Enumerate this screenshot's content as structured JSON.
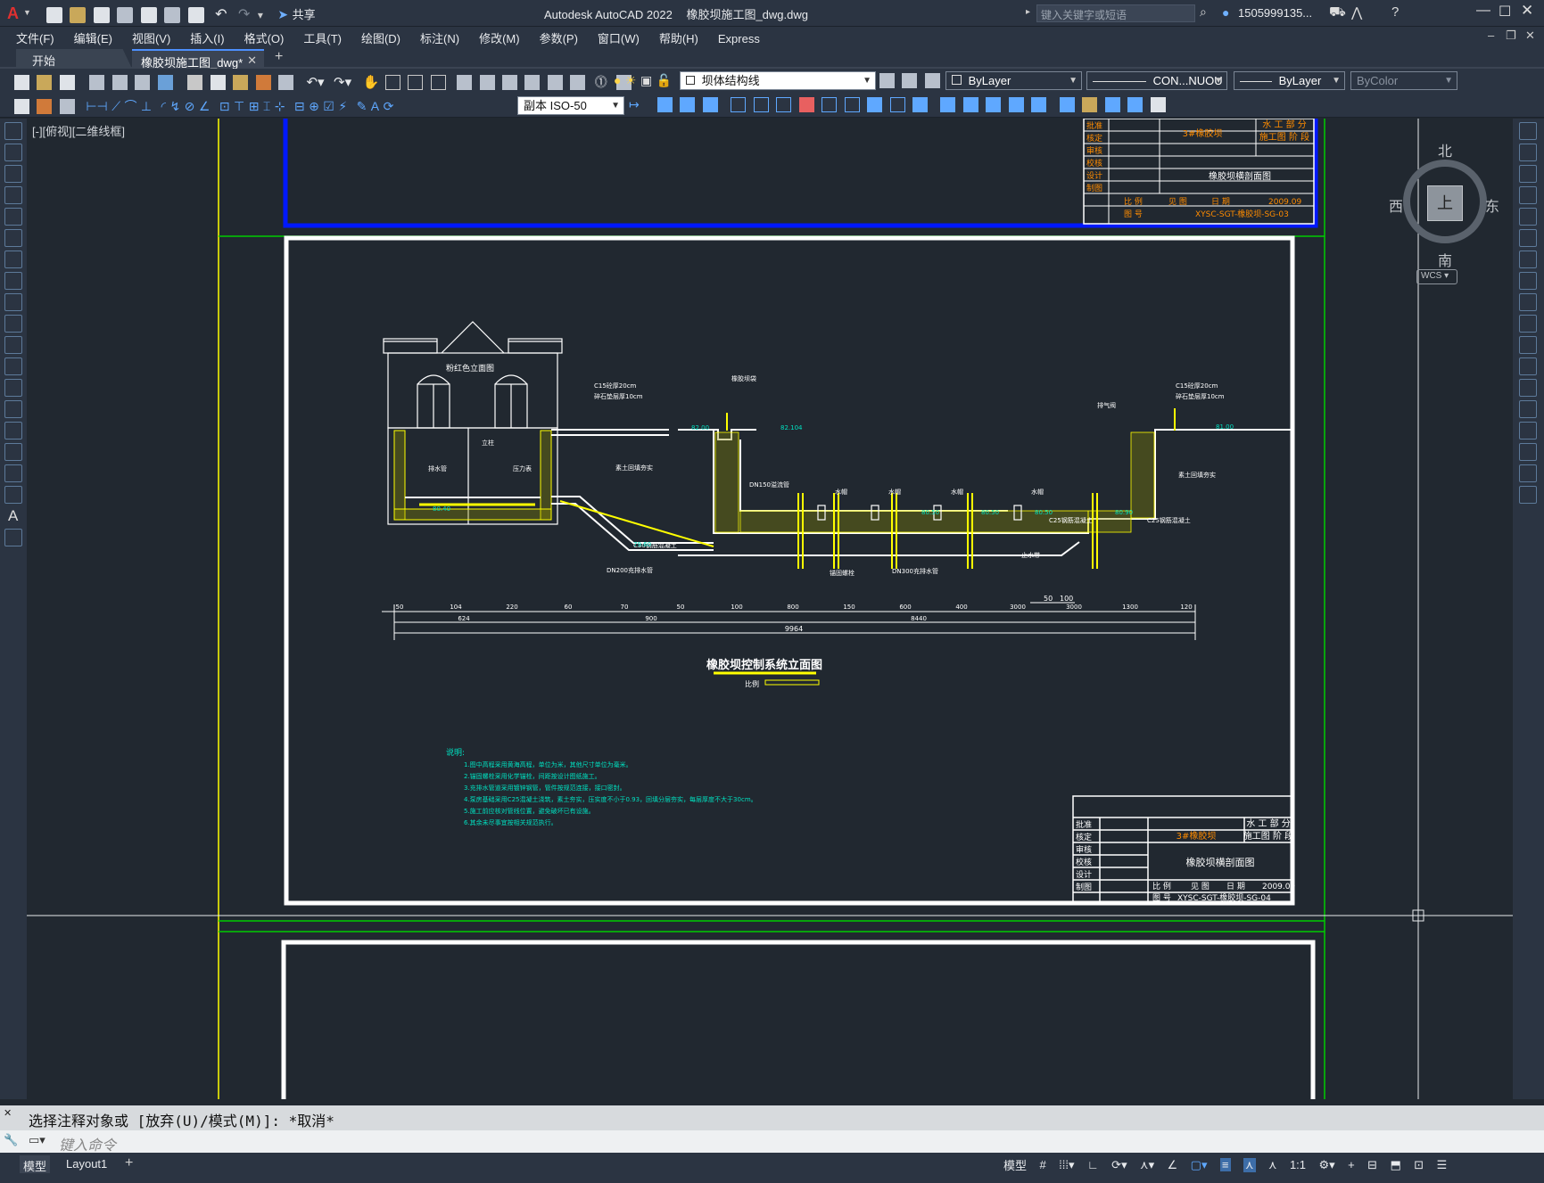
{
  "app": {
    "title": "Autodesk AutoCAD 2022",
    "filename": "橡胶坝施工图_dwg.dwg",
    "share_label": "共享",
    "search_placeholder": "键入关键字或短语",
    "user": "1505999135...",
    "logo_letter": "A"
  },
  "menu": [
    "文件(F)",
    "编辑(E)",
    "视图(V)",
    "插入(I)",
    "格式(O)",
    "工具(T)",
    "绘图(D)",
    "标注(N)",
    "修改(M)",
    "参数(P)",
    "窗口(W)",
    "帮助(H)",
    "Express"
  ],
  "tabs": [
    {
      "label": "开始",
      "active": false
    },
    {
      "label": "橡胶坝施工图_dwg*",
      "active": true
    }
  ],
  "toolbar": {
    "layer_value": "坝体结构线",
    "color_value": "ByLayer",
    "linetype_value": "CON...NUOU",
    "lineweight_value": "ByLayer",
    "plotstyle_value": "ByColor",
    "dimstyle_value": "副本 ISO-50"
  },
  "viewport": {
    "label": "[-][俯视][二维线框]",
    "viewcube": {
      "north": "北",
      "south": "南",
      "east": "东",
      "west": "西",
      "top": "上",
      "wcs": "WCS"
    }
  },
  "drawing": {
    "building_label": "粉红色立面图",
    "main_title": "橡胶坝控制系统立面图",
    "scale_label": "比例",
    "notes_title": "说明:",
    "notes": [
      "1.图中高程采用黄海高程，单位为米，其他尺寸单位为毫米。",
      "2.锚固螺栓采用化学锚栓，间距按设计图纸施工。",
      "3.充排水管道采用镀锌钢管，管件按规范连接，接口密封。",
      "4.泵房基础采用C25混凝土浇筑，素土夯实，压实度不小于0.93，回填分层夯实，每层厚度不大于30cm。",
      "5.施工前应核对管线位置，避免破坏已有设施。",
      "6.其余未尽事宜按相关规范执行。"
    ],
    "dims_top": [
      "50",
      "104",
      "220",
      "60",
      "70",
      "50",
      "100",
      "800",
      "150",
      "600",
      "400",
      "3000",
      "3000",
      "1300",
      "120"
    ],
    "dims_mid": [
      "624",
      "900",
      "8440"
    ],
    "dims_total": "9964",
    "dims_small": [
      "50",
      "100"
    ],
    "labels": [
      "C15砼厚20cm",
      "碎石垫层厚10cm",
      "橡胶坝袋",
      "C15砼厚20cm",
      "碎石垫层厚10cm",
      "素土回填夯实",
      "素土回填夯实",
      "水帽",
      "水帽",
      "水帽",
      "水帽",
      "排气阀",
      "压力表",
      "立柱",
      "DN200充排水管",
      "DN150溢流管",
      "DN300充排水管",
      "C25钢筋混凝土",
      "C25钢筋混凝土",
      "止水带",
      "锚固螺栓",
      "排水管",
      "C30钢筋混凝土"
    ],
    "elevations": [
      "82.00",
      "82.104",
      "80.40",
      "79.60",
      "80.50",
      "80.50",
      "80.50",
      "81.00",
      "80.90"
    ],
    "titleblock": {
      "roles": [
        "批准",
        "核定",
        "审核",
        "校核",
        "设计",
        "制图"
      ],
      "project": "3#橡胶坝",
      "dept": "水 工 部 分",
      "stage": "施工图 阶 段",
      "drawing_name": "橡胶坝横剖面图",
      "scale": "比 例",
      "scale_val": "见 图",
      "date_label": "日 期",
      "date": "2009.09",
      "number_label": "图 号",
      "number": "XYSC-SGT-橡胶坝-SG-04",
      "drawing_name_top": "橡胶坝横剖面图",
      "number_top": "XYSC-SGT-橡胶坝-SG-03"
    }
  },
  "command": {
    "history": "选择注释对象或 [放弃(U)/模式(M)]: *取消*",
    "input_placeholder": "键入命令"
  },
  "status": {
    "model_tab": "模型",
    "layout_tab": "Layout1",
    "model_label": "模型",
    "scale": "1:1"
  },
  "colors": {
    "bg": "#212830",
    "panel": "#2b3442",
    "green": "#00cc00",
    "yellow": "#ffff00",
    "blue": "#0018ff",
    "orange": "#ff8c00",
    "cyan": "#00e0c0"
  }
}
